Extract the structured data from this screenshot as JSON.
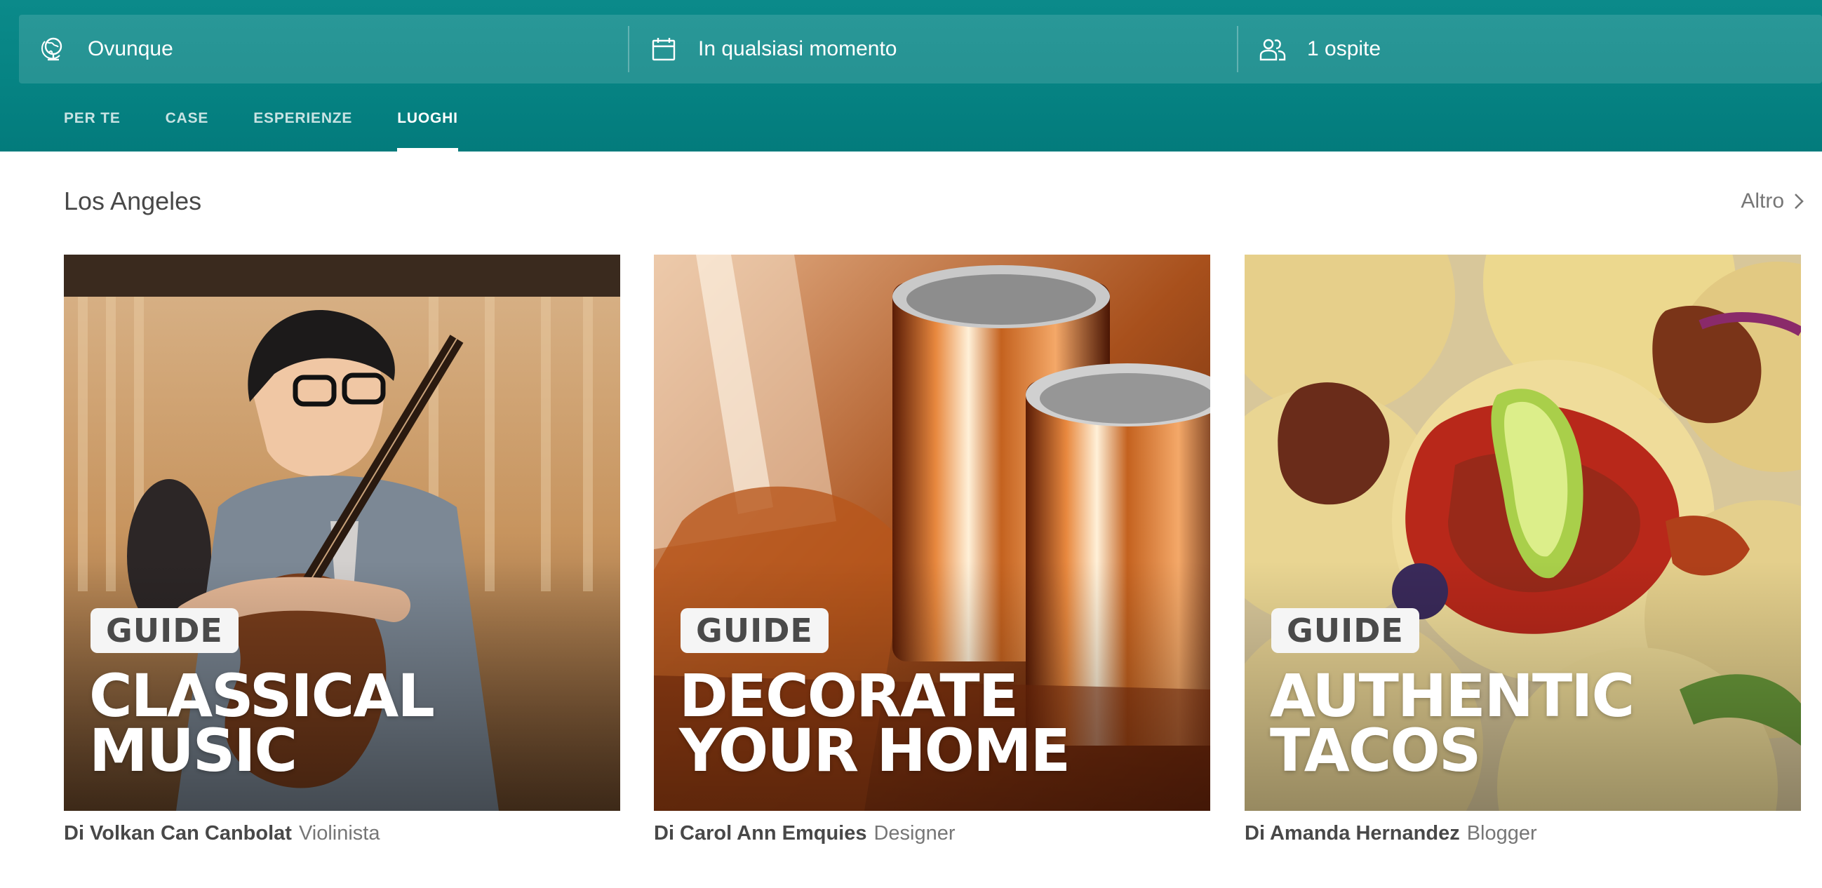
{
  "search": {
    "where_label": "Ovunque",
    "when_label": "In qualsiasi momento",
    "guests_label": "1 ospite"
  },
  "tabs": [
    {
      "label": "PER TE",
      "active": false
    },
    {
      "label": "CASE",
      "active": false
    },
    {
      "label": "ESPERIENZE",
      "active": false
    },
    {
      "label": "LUOGHI",
      "active": true
    }
  ],
  "section": {
    "title": "Los Angeles",
    "more_label": "Altro"
  },
  "cards": [
    {
      "badge": "GUIDE",
      "title_line1": "CLASSICAL",
      "title_line2": "MUSIC",
      "author": "Di Volkan Can Canbolat",
      "role": "Violinista"
    },
    {
      "badge": "GUIDE",
      "title_line1": "DECORATE",
      "title_line2": "YOUR HOME",
      "author": "Di Carol Ann Emquies",
      "role": "Designer"
    },
    {
      "badge": "GUIDE",
      "title_line1": "AUTHENTIC",
      "title_line2": "TACOS",
      "author": "Di Amanda Hernandez",
      "role": "Blogger"
    }
  ],
  "colors": {
    "header_teal": "#068383",
    "text_dark": "#484848",
    "text_muted": "#767676"
  }
}
